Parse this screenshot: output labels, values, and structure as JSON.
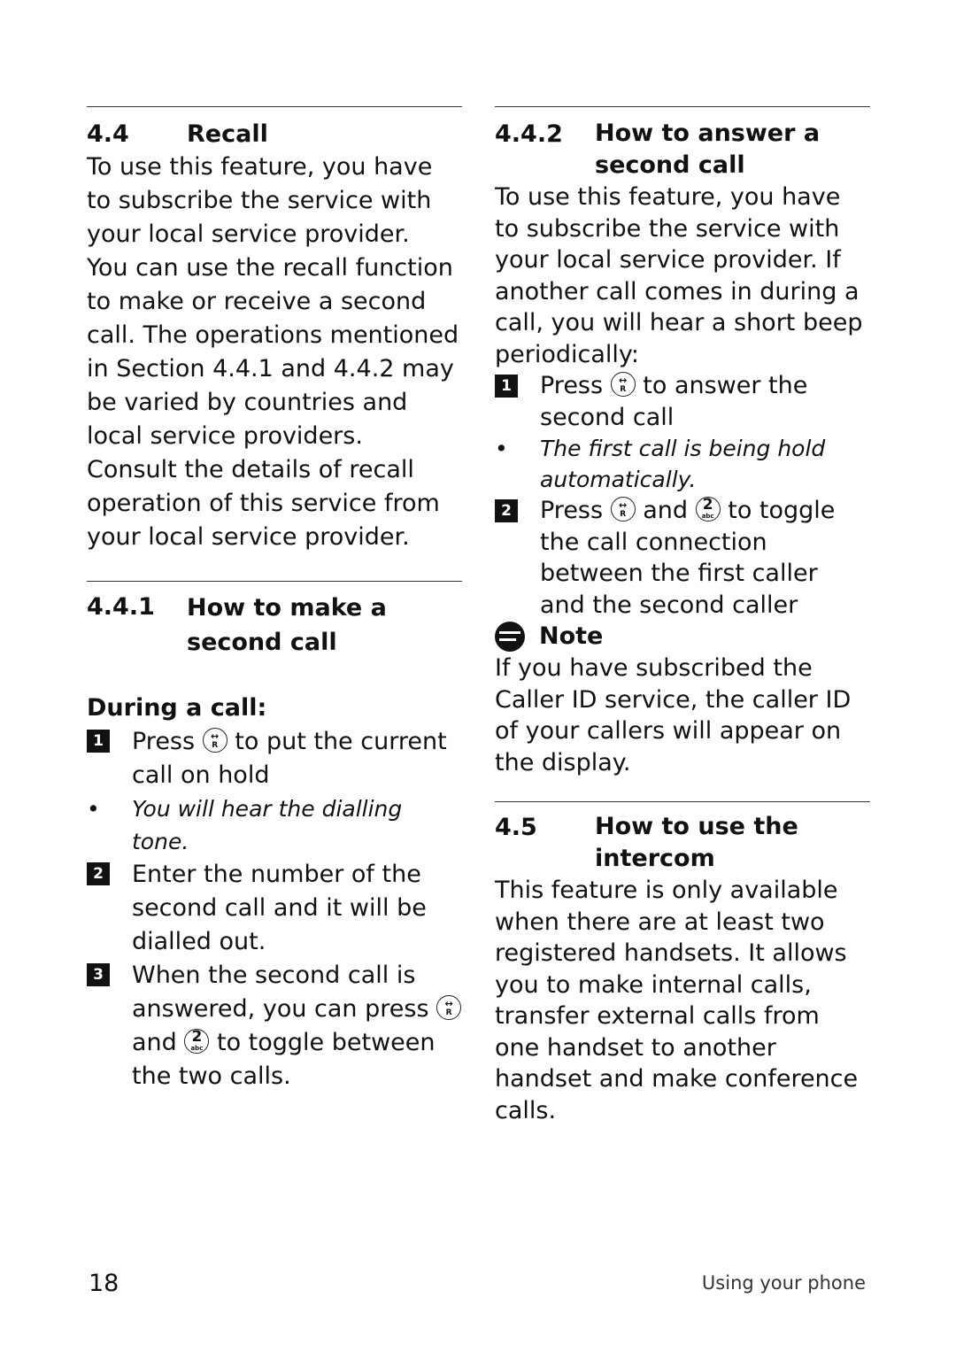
{
  "left": {
    "recall": {
      "num": "4.4",
      "title": "Recall",
      "para1": "To use this feature, you have to subscribe the service with your local service provider.",
      "para2": "You can use the recall function to make or receive a second call. The operations mentioned in Section 4.4.1 and 4.4.2 may be varied by countries and local service providers.",
      "para3": "Consult the details of recall operation of this service from your local service provider."
    },
    "make": {
      "num": "4.4.1",
      "title": "How to make a second call",
      "subhead": "During a call:",
      "step1_badge": "1",
      "step1_a": "Press",
      "step1_b": "to put the current call on hold",
      "bullet1": "You will hear the dialling tone.",
      "step2_badge": "2",
      "step2": "Enter the number of the second call and it will be dialled out.",
      "step3_badge": "3",
      "step3_a": "When the second call is answered, you can press",
      "step3_b": "and",
      "step3_c": "to toggle between the two calls."
    }
  },
  "right": {
    "answer": {
      "num": "4.4.2",
      "title": "How to answer a second call",
      "para": "To use this feature, you have to subscribe the service with your local service provider. If another call comes in during a call, you will hear a short beep periodically:",
      "step1_badge": "1",
      "step1_a": "Press",
      "step1_b": "to answer the second call",
      "bullet1": "The first call is being hold automatically.",
      "step2_badge": "2",
      "step2_a": "Press",
      "step2_b": "and",
      "step2_c": "to toggle the call connection between the first caller and the second caller",
      "note_title": "Note",
      "note_text": "If you have subscribed the Caller ID service, the caller ID of your callers will appear on the display."
    },
    "intercom": {
      "num": "4.5",
      "title": "How to use the intercom",
      "para": "This feature is only available when there are at least two registered handsets.  It allows you to make internal calls, transfer external calls from one handset to another handset and make conference calls."
    }
  },
  "icons": {
    "recall_top": "↔",
    "recall_bot": "R",
    "key2_top": "2",
    "key2_bot": "abc"
  },
  "footer": {
    "page_number": "18",
    "section": "Using your phone"
  }
}
